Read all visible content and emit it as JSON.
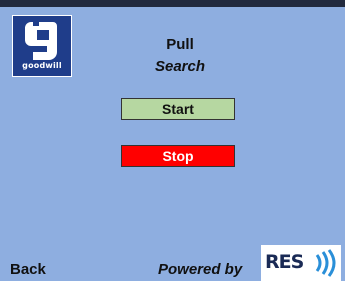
{
  "logo": {
    "text": "goodwill",
    "icon": "goodwill-g-icon"
  },
  "header": {
    "title": "Pull",
    "subtitle": "Search"
  },
  "buttons": {
    "start_label": "Start",
    "stop_label": "Stop"
  },
  "footer": {
    "back_label": "Back",
    "powered_by_label": "Powered by",
    "res_logo_text": "RES",
    "res_waves_icon": "signal-waves-icon"
  },
  "colors": {
    "screen_bg": "#8eaee0",
    "start_bg": "#b6d7a1",
    "stop_bg": "#ff0000",
    "logo_bg": "#1f3d8a"
  }
}
